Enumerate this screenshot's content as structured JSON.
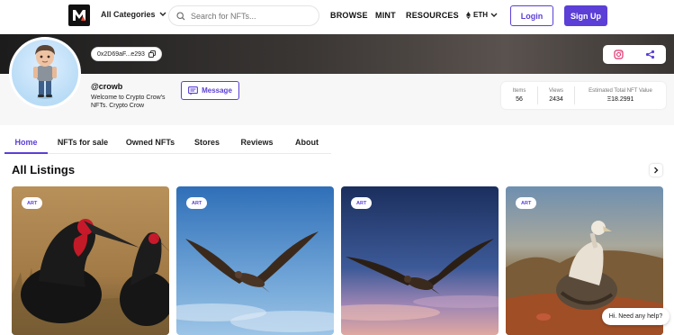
{
  "nav": {
    "categories_label": "All Categories",
    "search_placeholder": "Search for NFTs...",
    "links": [
      "BROWSE",
      "MINT",
      "RESOURCES"
    ],
    "currency": "ETH",
    "login_label": "Login",
    "signup_label": "Sign Up"
  },
  "profile": {
    "address": "0x2D69aF...e293",
    "username": "@crowb",
    "bio": "Welcome to Crypto Crow's NFTs. Crypto Crow",
    "message_label": "Message",
    "stats": [
      {
        "label": "Items",
        "value": "56"
      },
      {
        "label": "Views",
        "value": "2434"
      },
      {
        "label": "Estimated Total NFT Value",
        "value": "Ξ18.2991"
      }
    ]
  },
  "tabs": [
    "Home",
    "NFTs for sale",
    "Owned NFTs",
    "Stores",
    "Reviews",
    "About"
  ],
  "active_tab": "Home",
  "section_title": "All Listings",
  "listings": [
    {
      "tag": "ART"
    },
    {
      "tag": "ART"
    },
    {
      "tag": "ART"
    },
    {
      "tag": "ART"
    }
  ],
  "help_label": "Hi. Need any help?",
  "colors": {
    "accent": "#5b3fd6",
    "banner": "#2b2827"
  },
  "icons": [
    "logo-icon",
    "chevron-down-icon",
    "search-icon",
    "eth-icon",
    "copy-icon",
    "instagram-icon",
    "share-icon",
    "message-icon",
    "chevron-right-icon"
  ]
}
